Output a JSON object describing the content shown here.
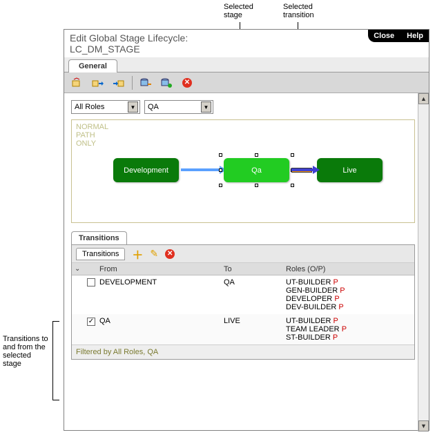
{
  "callouts": {
    "selected_stage": "Selected\nstage",
    "selected_transition": "Selected\ntransition",
    "left_note": "Transitions to and from the selected stage"
  },
  "window": {
    "title_line1": "Edit Global Stage Lifecycle:",
    "title_line2": "LC_DM_STAGE",
    "close": "Close",
    "help": "Help"
  },
  "tabs": {
    "general": "General"
  },
  "filters": {
    "roles": "All Roles",
    "stage": "QA"
  },
  "canvas": {
    "note": "NORMAL\nPATH\nONLY",
    "stages": {
      "dev": "Development",
      "qa": "Qa",
      "live": "Live"
    }
  },
  "transitions": {
    "section_label": "Transitions",
    "subtab": "Transitions",
    "headers": {
      "from": "From",
      "to": "To",
      "roles": "Roles (O/P)"
    },
    "rows": [
      {
        "checked": false,
        "from": "DEVELOPMENT",
        "to": "QA",
        "roles": [
          "UT-BUILDER",
          "GEN-BUILDER",
          "DEVELOPER",
          "DEV-BUILDER"
        ],
        "flag": "P"
      },
      {
        "checked": true,
        "from": "QA",
        "to": "LIVE",
        "roles": [
          "UT-BUILDER",
          "TEAM LEADER",
          "ST-BUILDER"
        ],
        "flag": "P"
      }
    ],
    "filter_note": "Filtered by All Roles, QA"
  }
}
